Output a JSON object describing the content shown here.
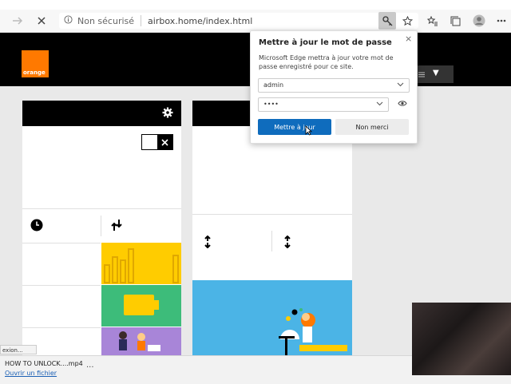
{
  "browser": {
    "security_label": "Non sécurisé",
    "url": "airbox.home/index.html",
    "icons": [
      "forward-icon",
      "stop-icon",
      "info-icon",
      "key-icon",
      "star-icon",
      "favorites-icon",
      "collections-icon",
      "profile-icon",
      "more-icon"
    ]
  },
  "page": {
    "brand": "orange",
    "menu_icon": "caret-down"
  },
  "password_popup": {
    "title": "Mettre à jour le mot de passe",
    "close": "×",
    "description": "Microsoft Edge mettra à jour votre mot de passe enregistré pour ce site.",
    "username": "admin",
    "password": "••••",
    "update_button": "Mettre à jour",
    "cancel_button": "Non merci"
  },
  "status_tooltip": "exion...",
  "download": {
    "filename": "HOW TO UNLOCK....mp4",
    "open_link": "Ouvrir un fichier",
    "more": "..."
  },
  "colors": {
    "brand_orange": "#ff7900",
    "header_black": "#000000",
    "tile_yellow": "#ffcc00",
    "tile_green": "#3dbc7a",
    "tile_purple": "#a885d8",
    "tile_blue": "#4bb4e6",
    "edge_blue": "#0f6cbd"
  }
}
